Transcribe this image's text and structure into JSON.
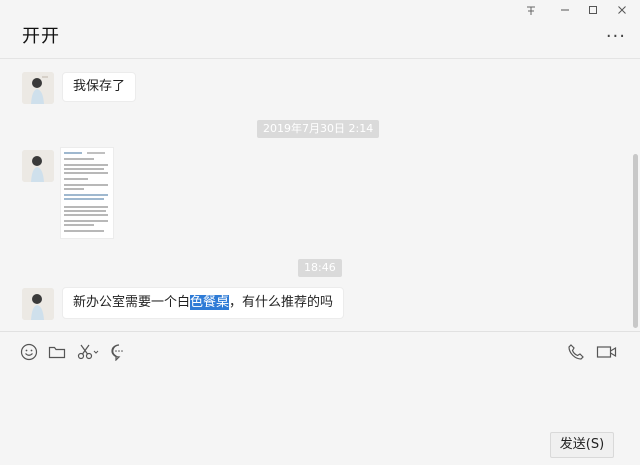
{
  "window": {
    "title": "开开",
    "controls": [
      "pin-icon",
      "minimize-icon",
      "maximize-icon",
      "close-icon"
    ],
    "more_label": "···"
  },
  "messages": [
    {
      "type": "text",
      "text": "我保存了"
    },
    {
      "type": "timestamp",
      "text": "2019年7月30日 2:14"
    },
    {
      "type": "image",
      "desc": "screenshot-thumbnail"
    },
    {
      "type": "timestamp",
      "text": "18:46"
    },
    {
      "type": "text",
      "parts": [
        "新办公室需要一个白",
        "色餐桌",
        "，有什么推荐的吗"
      ]
    }
  ],
  "toolbar": {
    "left_icons": [
      "emoji-icon",
      "folder-icon",
      "scissors-icon",
      "chat-history-icon"
    ],
    "right_icons": [
      "phone-icon",
      "video-icon"
    ]
  },
  "send_button": {
    "label": "发送(S)"
  },
  "colors": {
    "background": "#f5f5f5",
    "bubble": "#ffffff",
    "selection": "#2e7bd6",
    "timestamp_bg": "#dadada"
  }
}
